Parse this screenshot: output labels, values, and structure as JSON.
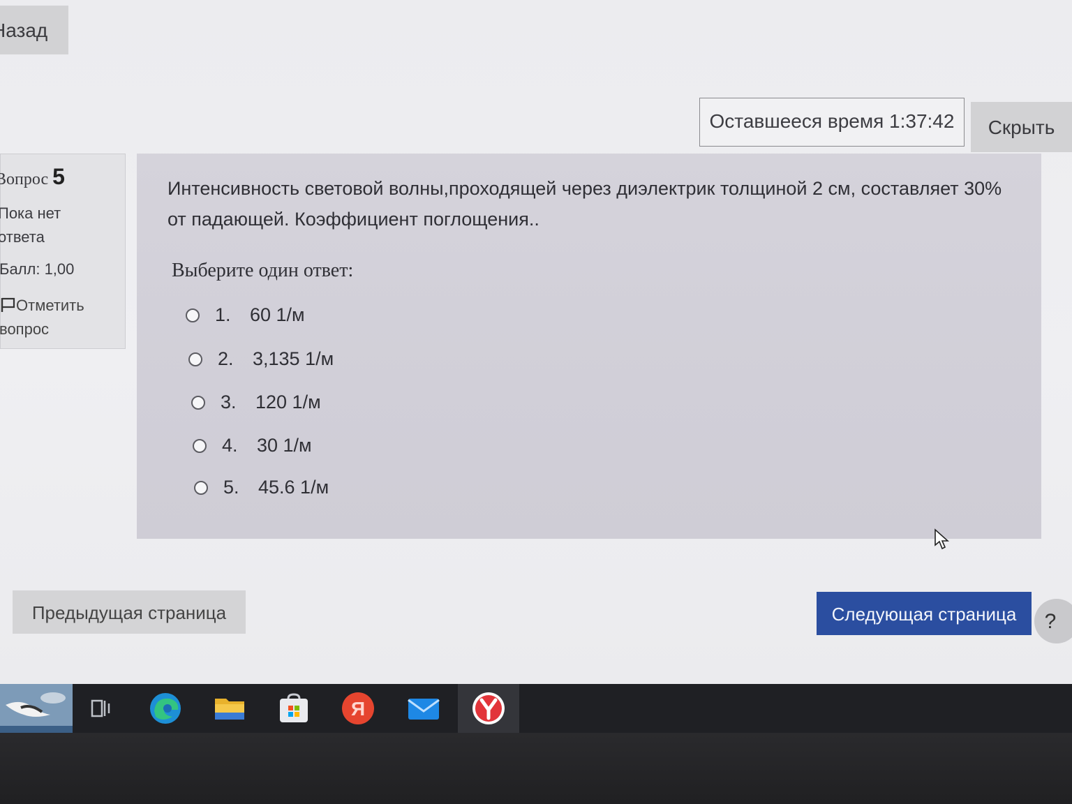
{
  "header": {
    "back_label": "Назад",
    "timer_text": "Оставшееся время 1:37:42",
    "hide_label": "Скрыть"
  },
  "info": {
    "question_word": "Вопрос",
    "question_number": "5",
    "status": "Пока нет ответа",
    "mark": "Балл: 1,00",
    "flag_label": "Отметить вопрос"
  },
  "question": {
    "text": "Интенсивность световой волны,проходящей через диэлектрик толщиной 2 см, составляет 30% от падающей. Коэффициент поглощения..",
    "prompt": "Выберите один ответ:",
    "options": [
      {
        "num": "1.",
        "label": "60 1/м"
      },
      {
        "num": "2.",
        "label": "3,135 1/м"
      },
      {
        "num": "3.",
        "label": "120 1/м"
      },
      {
        "num": "4.",
        "label": "30 1/м"
      },
      {
        "num": "5.",
        "label": "45.6 1/м"
      }
    ]
  },
  "navigation": {
    "prev_label": "Предыдущая страница",
    "next_label": "Следующая страница",
    "help_label": "?"
  },
  "colors": {
    "next_button": "#2b4ea0",
    "card_background": "#d3d1da",
    "taskbar": "#1f2024"
  },
  "taskbar": {
    "icons": [
      "weather-widget-icon",
      "task-view-icon",
      "edge-icon",
      "file-explorer-icon",
      "microsoft-store-icon",
      "yandex-icon",
      "mail-icon",
      "yandex-browser-icon"
    ],
    "yandex_letter": "Я"
  }
}
